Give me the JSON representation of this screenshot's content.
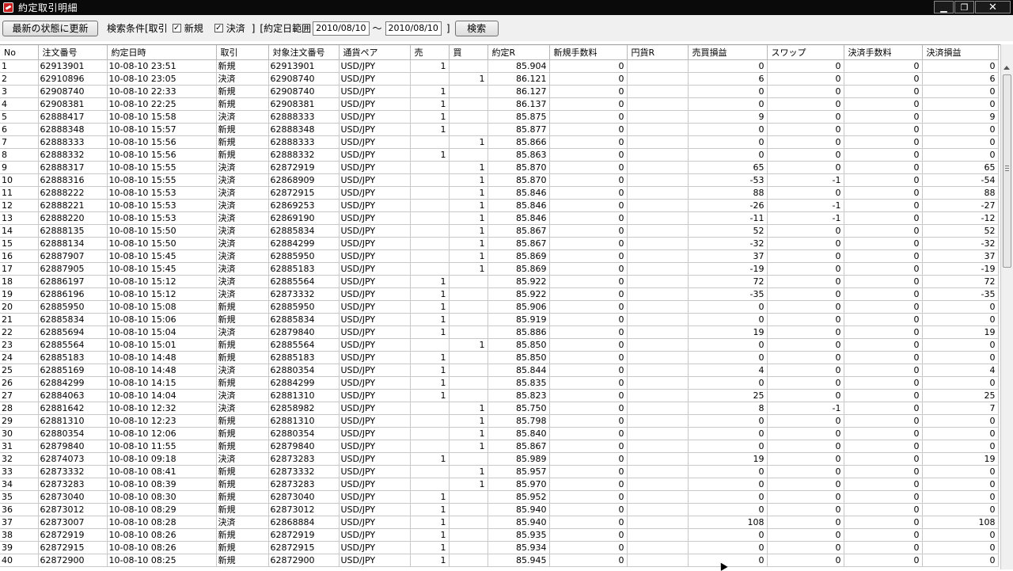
{
  "window": {
    "title": "約定取引明細"
  },
  "toolbar": {
    "update_label": "最新の状態に更新",
    "criteria_label": "検索条件[取引",
    "check_new": {
      "label": "新規",
      "checked": true
    },
    "check_settle": {
      "label": "決済",
      "checked": true
    },
    "bracket_close": "]",
    "date_range_label": "[約定日範囲",
    "date_from": "2010/08/10",
    "tilde": "～",
    "date_to": "2010/08/10",
    "date_close": "]",
    "search_label": "検索"
  },
  "columns": [
    "No",
    "注文番号",
    "約定日時",
    "取引",
    "対象注文番号",
    "通貨ペア",
    "売",
    "買",
    "約定R",
    "新規手数料",
    "円貨R",
    "売買損益",
    "スワップ",
    "決済手数料",
    "決済損益"
  ],
  "rows": [
    [
      "1",
      "62913901",
      "10-08-10 23:51",
      "新規",
      "62913901",
      "USD/JPY",
      "1",
      "",
      "85.904",
      "0",
      "",
      "0",
      "0",
      "0",
      "0"
    ],
    [
      "2",
      "62910896",
      "10-08-10 23:05",
      "決済",
      "62908740",
      "USD/JPY",
      "",
      "1",
      "86.121",
      "0",
      "",
      "6",
      "0",
      "0",
      "6"
    ],
    [
      "3",
      "62908740",
      "10-08-10 22:33",
      "新規",
      "62908740",
      "USD/JPY",
      "1",
      "",
      "86.127",
      "0",
      "",
      "0",
      "0",
      "0",
      "0"
    ],
    [
      "4",
      "62908381",
      "10-08-10 22:25",
      "新規",
      "62908381",
      "USD/JPY",
      "1",
      "",
      "86.137",
      "0",
      "",
      "0",
      "0",
      "0",
      "0"
    ],
    [
      "5",
      "62888417",
      "10-08-10 15:58",
      "決済",
      "62888333",
      "USD/JPY",
      "1",
      "",
      "85.875",
      "0",
      "",
      "9",
      "0",
      "0",
      "9"
    ],
    [
      "6",
      "62888348",
      "10-08-10 15:57",
      "新規",
      "62888348",
      "USD/JPY",
      "1",
      "",
      "85.877",
      "0",
      "",
      "0",
      "0",
      "0",
      "0"
    ],
    [
      "7",
      "62888333",
      "10-08-10 15:56",
      "新規",
      "62888333",
      "USD/JPY",
      "",
      "1",
      "85.866",
      "0",
      "",
      "0",
      "0",
      "0",
      "0"
    ],
    [
      "8",
      "62888332",
      "10-08-10 15:56",
      "新規",
      "62888332",
      "USD/JPY",
      "1",
      "",
      "85.863",
      "0",
      "",
      "0",
      "0",
      "0",
      "0"
    ],
    [
      "9",
      "62888317",
      "10-08-10 15:55",
      "決済",
      "62872919",
      "USD/JPY",
      "",
      "1",
      "85.870",
      "0",
      "",
      "65",
      "0",
      "0",
      "65"
    ],
    [
      "10",
      "62888316",
      "10-08-10 15:55",
      "決済",
      "62868909",
      "USD/JPY",
      "",
      "1",
      "85.870",
      "0",
      "",
      "-53",
      "-1",
      "0",
      "-54"
    ],
    [
      "11",
      "62888222",
      "10-08-10 15:53",
      "決済",
      "62872915",
      "USD/JPY",
      "",
      "1",
      "85.846",
      "0",
      "",
      "88",
      "0",
      "0",
      "88"
    ],
    [
      "12",
      "62888221",
      "10-08-10 15:53",
      "決済",
      "62869253",
      "USD/JPY",
      "",
      "1",
      "85.846",
      "0",
      "",
      "-26",
      "-1",
      "0",
      "-27"
    ],
    [
      "13",
      "62888220",
      "10-08-10 15:53",
      "決済",
      "62869190",
      "USD/JPY",
      "",
      "1",
      "85.846",
      "0",
      "",
      "-11",
      "-1",
      "0",
      "-12"
    ],
    [
      "14",
      "62888135",
      "10-08-10 15:50",
      "決済",
      "62885834",
      "USD/JPY",
      "",
      "1",
      "85.867",
      "0",
      "",
      "52",
      "0",
      "0",
      "52"
    ],
    [
      "15",
      "62888134",
      "10-08-10 15:50",
      "決済",
      "62884299",
      "USD/JPY",
      "",
      "1",
      "85.867",
      "0",
      "",
      "-32",
      "0",
      "0",
      "-32"
    ],
    [
      "16",
      "62887907",
      "10-08-10 15:45",
      "決済",
      "62885950",
      "USD/JPY",
      "",
      "1",
      "85.869",
      "0",
      "",
      "37",
      "0",
      "0",
      "37"
    ],
    [
      "17",
      "62887905",
      "10-08-10 15:45",
      "決済",
      "62885183",
      "USD/JPY",
      "",
      "1",
      "85.869",
      "0",
      "",
      "-19",
      "0",
      "0",
      "-19"
    ],
    [
      "18",
      "62886197",
      "10-08-10 15:12",
      "決済",
      "62885564",
      "USD/JPY",
      "1",
      "",
      "85.922",
      "0",
      "",
      "72",
      "0",
      "0",
      "72"
    ],
    [
      "19",
      "62886196",
      "10-08-10 15:12",
      "決済",
      "62873332",
      "USD/JPY",
      "1",
      "",
      "85.922",
      "0",
      "",
      "-35",
      "0",
      "0",
      "-35"
    ],
    [
      "20",
      "62885950",
      "10-08-10 15:08",
      "新規",
      "62885950",
      "USD/JPY",
      "1",
      "",
      "85.906",
      "0",
      "",
      "0",
      "0",
      "0",
      "0"
    ],
    [
      "21",
      "62885834",
      "10-08-10 15:06",
      "新規",
      "62885834",
      "USD/JPY",
      "1",
      "",
      "85.919",
      "0",
      "",
      "0",
      "0",
      "0",
      "0"
    ],
    [
      "22",
      "62885694",
      "10-08-10 15:04",
      "決済",
      "62879840",
      "USD/JPY",
      "1",
      "",
      "85.886",
      "0",
      "",
      "19",
      "0",
      "0",
      "19"
    ],
    [
      "23",
      "62885564",
      "10-08-10 15:01",
      "新規",
      "62885564",
      "USD/JPY",
      "",
      "1",
      "85.850",
      "0",
      "",
      "0",
      "0",
      "0",
      "0"
    ],
    [
      "24",
      "62885183",
      "10-08-10 14:48",
      "新規",
      "62885183",
      "USD/JPY",
      "1",
      "",
      "85.850",
      "0",
      "",
      "0",
      "0",
      "0",
      "0"
    ],
    [
      "25",
      "62885169",
      "10-08-10 14:48",
      "決済",
      "62880354",
      "USD/JPY",
      "1",
      "",
      "85.844",
      "0",
      "",
      "4",
      "0",
      "0",
      "4"
    ],
    [
      "26",
      "62884299",
      "10-08-10 14:15",
      "新規",
      "62884299",
      "USD/JPY",
      "1",
      "",
      "85.835",
      "0",
      "",
      "0",
      "0",
      "0",
      "0"
    ],
    [
      "27",
      "62884063",
      "10-08-10 14:04",
      "決済",
      "62881310",
      "USD/JPY",
      "1",
      "",
      "85.823",
      "0",
      "",
      "25",
      "0",
      "0",
      "25"
    ],
    [
      "28",
      "62881642",
      "10-08-10 12:32",
      "決済",
      "62858982",
      "USD/JPY",
      "",
      "1",
      "85.750",
      "0",
      "",
      "8",
      "-1",
      "0",
      "7"
    ],
    [
      "29",
      "62881310",
      "10-08-10 12:23",
      "新規",
      "62881310",
      "USD/JPY",
      "",
      "1",
      "85.798",
      "0",
      "",
      "0",
      "0",
      "0",
      "0"
    ],
    [
      "30",
      "62880354",
      "10-08-10 12:06",
      "新規",
      "62880354",
      "USD/JPY",
      "",
      "1",
      "85.840",
      "0",
      "",
      "0",
      "0",
      "0",
      "0"
    ],
    [
      "31",
      "62879840",
      "10-08-10 11:55",
      "新規",
      "62879840",
      "USD/JPY",
      "",
      "1",
      "85.867",
      "0",
      "",
      "0",
      "0",
      "0",
      "0"
    ],
    [
      "32",
      "62874073",
      "10-08-10 09:18",
      "決済",
      "62873283",
      "USD/JPY",
      "1",
      "",
      "85.989",
      "0",
      "",
      "19",
      "0",
      "0",
      "19"
    ],
    [
      "33",
      "62873332",
      "10-08-10 08:41",
      "新規",
      "62873332",
      "USD/JPY",
      "",
      "1",
      "85.957",
      "0",
      "",
      "0",
      "0",
      "0",
      "0"
    ],
    [
      "34",
      "62873283",
      "10-08-10 08:39",
      "新規",
      "62873283",
      "USD/JPY",
      "",
      "1",
      "85.970",
      "0",
      "",
      "0",
      "0",
      "0",
      "0"
    ],
    [
      "35",
      "62873040",
      "10-08-10 08:30",
      "新規",
      "62873040",
      "USD/JPY",
      "1",
      "",
      "85.952",
      "0",
      "",
      "0",
      "0",
      "0",
      "0"
    ],
    [
      "36",
      "62873012",
      "10-08-10 08:29",
      "新規",
      "62873012",
      "USD/JPY",
      "1",
      "",
      "85.940",
      "0",
      "",
      "0",
      "0",
      "0",
      "0"
    ],
    [
      "37",
      "62873007",
      "10-08-10 08:28",
      "決済",
      "62868884",
      "USD/JPY",
      "1",
      "",
      "85.940",
      "0",
      "",
      "108",
      "0",
      "0",
      "108"
    ],
    [
      "38",
      "62872919",
      "10-08-10 08:26",
      "新規",
      "62872919",
      "USD/JPY",
      "1",
      "",
      "85.935",
      "0",
      "",
      "0",
      "0",
      "0",
      "0"
    ],
    [
      "39",
      "62872915",
      "10-08-10 08:26",
      "新規",
      "62872915",
      "USD/JPY",
      "1",
      "",
      "85.934",
      "0",
      "",
      "0",
      "0",
      "0",
      "0"
    ],
    [
      "40",
      "62872900",
      "10-08-10 08:25",
      "新規",
      "62872900",
      "USD/JPY",
      "1",
      "",
      "85.945",
      "0",
      "",
      "0",
      "0",
      "0",
      "0"
    ]
  ]
}
